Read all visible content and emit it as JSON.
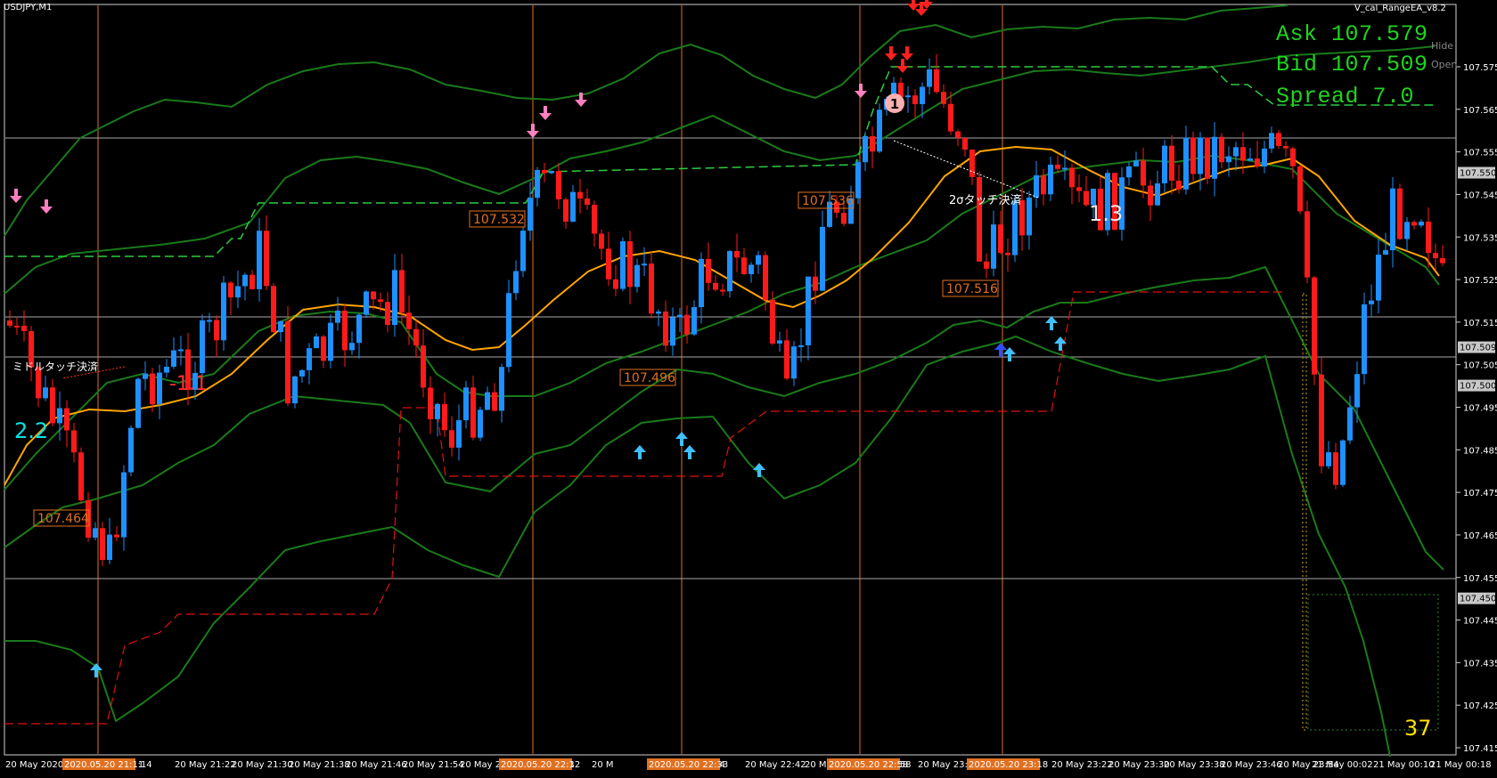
{
  "window": {
    "symbol_label": "USDJPY,M1",
    "ea_label": "V_cal_RangeEA_v8.2",
    "hide_label": "Hide",
    "open_label": "Open"
  },
  "hud": {
    "ask": "Ask 107.579",
    "bid": "Bid 107.509",
    "spread": "Spread 7.0"
  },
  "price_axis": {
    "ticks": [
      "107.575",
      "107.565",
      "107.555",
      "107.545",
      "107.535",
      "107.525",
      "107.515",
      "107.505",
      "107.495",
      "107.485",
      "107.475",
      "107.465",
      "107.455",
      "107.445",
      "107.435",
      "107.425",
      "107.415"
    ],
    "highlights": [
      "107.550",
      "107.509",
      "107.500",
      "107.450"
    ]
  },
  "time_axis": {
    "labels": [
      "20 May 2020",
      "May 21:14",
      "20 May 21:22",
      "20 May 21:30",
      "20 May 21:38",
      "20 May 21:46",
      "20 May 21:54",
      "20 May 2",
      "20 May 22:18",
      "20 M",
      "22:34",
      "20 May 22:42",
      "20 Ma",
      "2:58",
      "20 May 23:06",
      "20 May 23:22",
      "20 May 23:30",
      "20 May 23:38",
      "20 May 23:46",
      "20 May 23:54",
      "21 May 00:02",
      "21 May 00:10",
      "21 May 00:18"
    ],
    "highlights": [
      "2020.05.20 21:11",
      "2020.05.20 22:12",
      "2020.05.20 22:33",
      "2020.05.20 22:58",
      "2020.05.20 23:18"
    ]
  },
  "annotations": {
    "price_boxes": [
      "107.464",
      "107.532",
      "107.496",
      "107.536",
      "107.516"
    ],
    "midline_touch": "ミドルタッチ決済",
    "sigma_touch": "2σタッチ決済",
    "value_neg": "-1.1",
    "value_2_2": "2.2",
    "value_1_3": "1.3",
    "value_37": "37",
    "circle_one": "1"
  },
  "colors": {
    "background": "#000000",
    "bull_candle": "#1e90ff",
    "bear_candle": "#ff1a1a",
    "band": "#1a7a1a",
    "ma": "#ffa500",
    "hud": "#1fd41f",
    "box_border": "#e07020"
  }
}
